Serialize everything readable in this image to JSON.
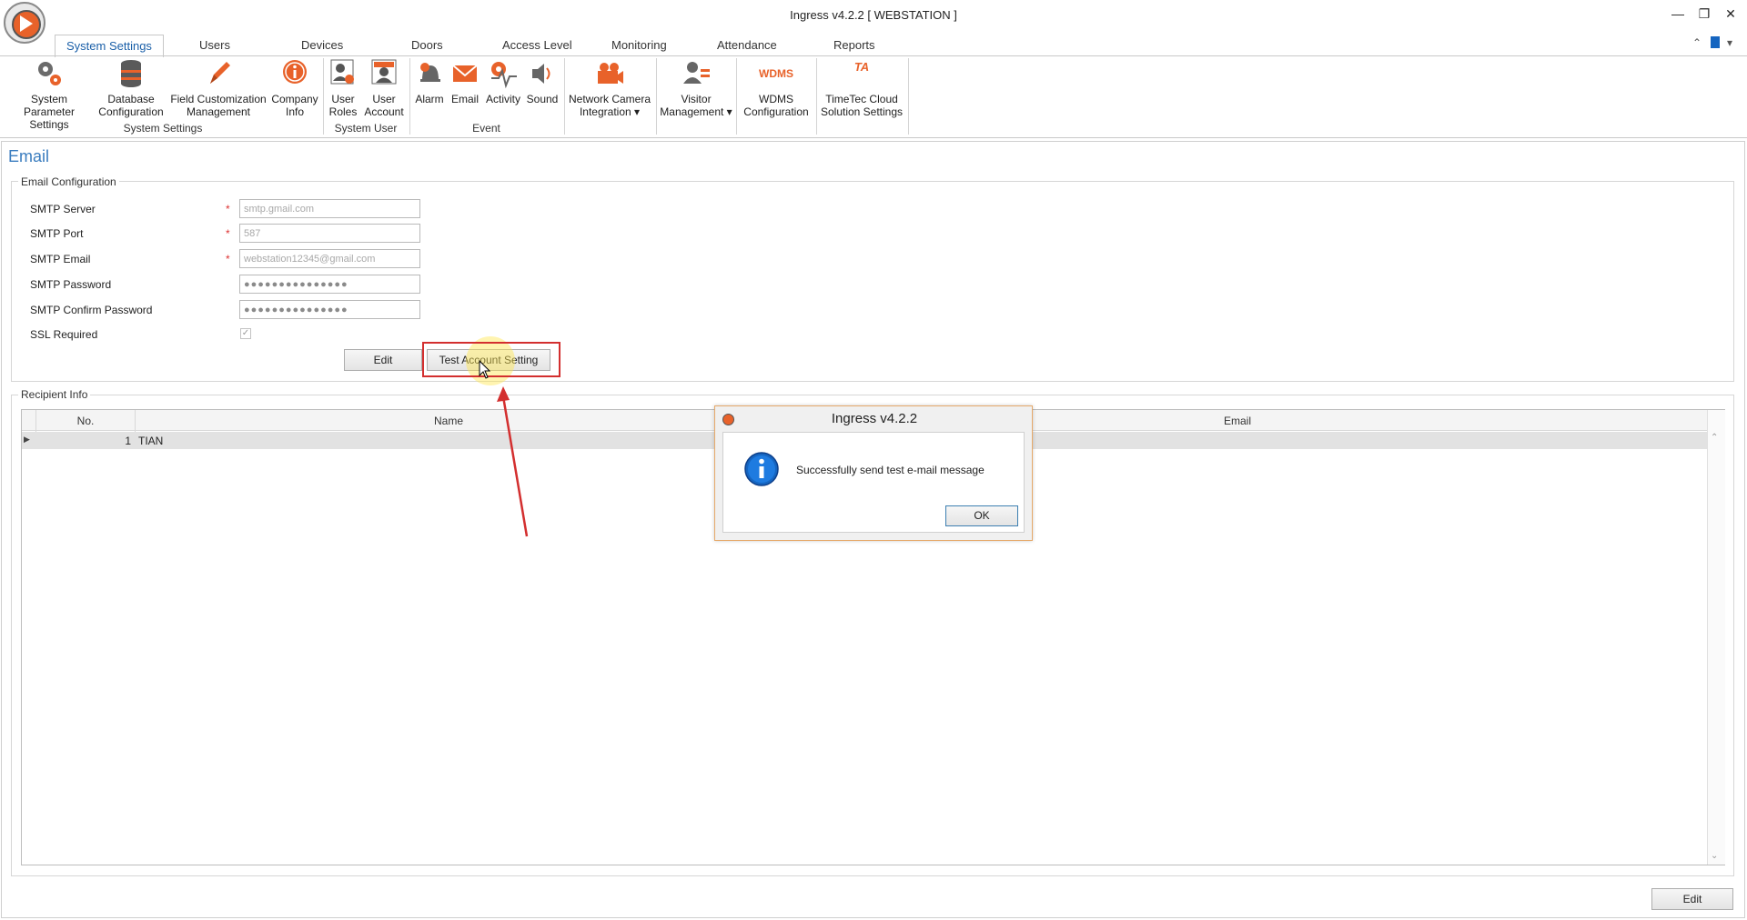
{
  "window": {
    "title": "Ingress v4.2.2 [ WEBSTATION ]",
    "minimize": "—",
    "restore": "❐",
    "close": "✕"
  },
  "tabs": [
    {
      "label": "System Settings",
      "active": true
    },
    {
      "label": "Users"
    },
    {
      "label": "Devices"
    },
    {
      "label": "Doors"
    },
    {
      "label": "Access Level"
    },
    {
      "label": "Monitoring"
    },
    {
      "label": "Attendance"
    },
    {
      "label": "Reports"
    }
  ],
  "ribbon": {
    "system_settings": {
      "group_label": "System Settings",
      "items": [
        {
          "line1": "System Parameter",
          "line2": "Settings",
          "icon": "gears-icon"
        },
        {
          "line1": "Database",
          "line2": "Configuration",
          "icon": "database-icon"
        },
        {
          "line1": "Field Customization",
          "line2": "Management",
          "icon": "pencil-icon"
        },
        {
          "line1": "Company",
          "line2": "Info",
          "icon": "info-icon"
        }
      ]
    },
    "system_user": {
      "group_label": "System User",
      "items": [
        {
          "line1": "User",
          "line2": "Roles",
          "icon": "user-roles-icon"
        },
        {
          "line1": "User",
          "line2": "Account",
          "icon": "user-account-icon"
        }
      ]
    },
    "event": {
      "group_label": "Event",
      "items": [
        {
          "line1": "Alarm",
          "icon": "alarm-bell-icon"
        },
        {
          "line1": "Email",
          "icon": "email-envelope-icon"
        },
        {
          "line1": "Activity",
          "icon": "activity-pulse-icon"
        },
        {
          "line1": "Sound",
          "icon": "speaker-icon"
        }
      ]
    },
    "network_camera": {
      "line1": "Network Camera",
      "line2": "Integration",
      "icon": "camera-icon"
    },
    "visitor": {
      "line1": "Visitor",
      "line2": "Management",
      "icon": "visitor-icon"
    },
    "wdms": {
      "line1": "WDMS",
      "line2": "Configuration",
      "icon_text": "WDMS"
    },
    "timetec": {
      "line1": "TimeTec Cloud",
      "line2": "Solution Settings",
      "icon_text": "TA"
    }
  },
  "page": {
    "title": "Email",
    "email_config": {
      "legend": "Email Configuration",
      "fields": {
        "smtp_server": {
          "label": "SMTP Server",
          "value": "smtp.gmail.com",
          "required": "*"
        },
        "smtp_port": {
          "label": "SMTP Port",
          "value": "587",
          "required": "*"
        },
        "smtp_email": {
          "label": "SMTP Email",
          "value": "webstation12345@gmail.com",
          "required": "*"
        },
        "smtp_password": {
          "label": "SMTP Password",
          "value": "●●●●●●●●●●●●●●●"
        },
        "smtp_confirm_password": {
          "label": "SMTP Confirm Password",
          "value": "●●●●●●●●●●●●●●●"
        },
        "ssl_required": {
          "label": "SSL Required",
          "checked": true,
          "mark": "✓"
        }
      },
      "edit_button": "Edit",
      "test_button": "Test Account Setting"
    },
    "recipient_info": {
      "legend": "Recipient Info",
      "columns": [
        "No.",
        "Name",
        "Email"
      ],
      "rows": [
        {
          "no": "1",
          "name": "TIAN",
          "email": ""
        }
      ]
    },
    "bottom_edit_button": "Edit"
  },
  "dialog": {
    "title": "Ingress v4.2.2",
    "message": "Successfully send test e-mail message",
    "ok_button": "OK"
  },
  "colors": {
    "accent": "#1a5fa8",
    "orange": "#e8622a",
    "highlight_box": "#d32f2f",
    "arrow": "#d32f2f",
    "selected_row": "#e2e2e2"
  }
}
